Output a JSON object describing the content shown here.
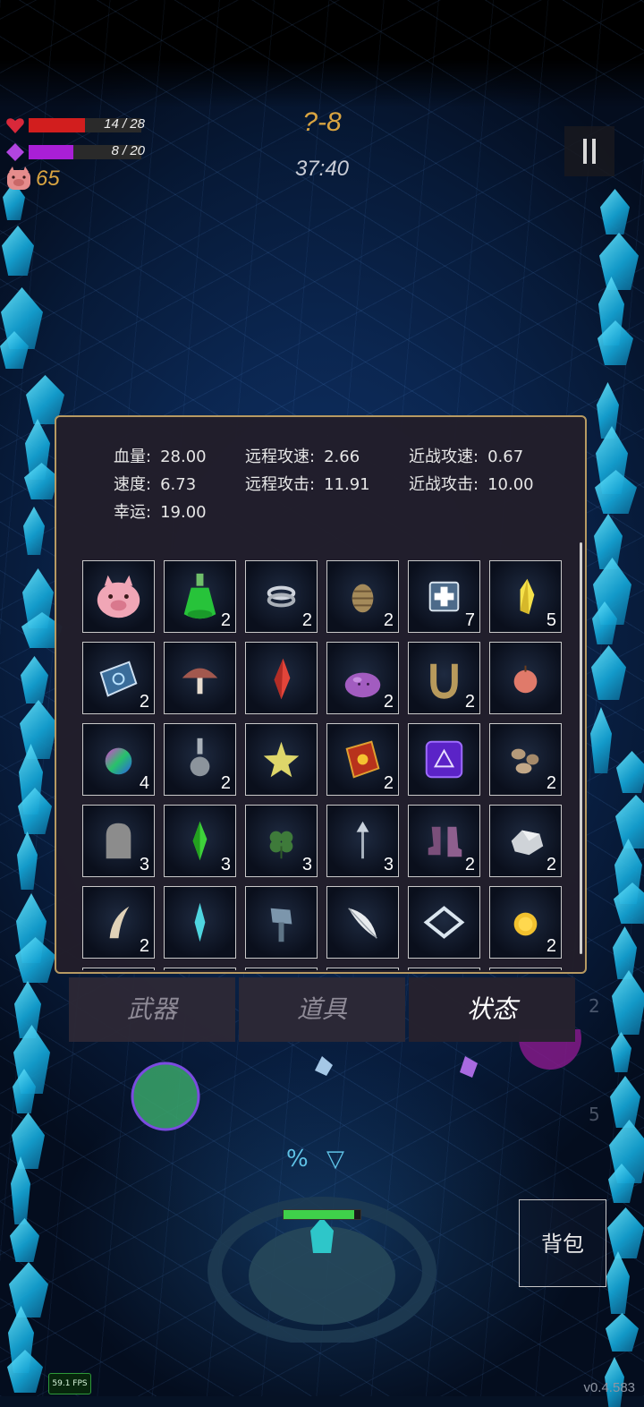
{
  "hud": {
    "hp_text": "14 / 28",
    "hp_current": 14,
    "hp_max": 28,
    "mp_text": "8 / 20",
    "mp_current": 8,
    "mp_max": 20,
    "coins": "65",
    "level": "?-8",
    "timer": "37:40",
    "hp_color": "#d21e1e",
    "mp_color": "#a91fd6",
    "level_color": "#d9a441"
  },
  "stats": {
    "hp_label": "血量:",
    "hp_value": "28.00",
    "speed_label": "速度:",
    "speed_value": "6.73",
    "luck_label": "幸运:",
    "luck_value": "19.00",
    "ranged_speed_label": "远程攻速:",
    "ranged_speed_value": "2.66",
    "ranged_atk_label": "远程攻击:",
    "ranged_atk_value": "11.91",
    "melee_speed_label": "近战攻速:",
    "melee_speed_value": "0.67",
    "melee_atk_label": "近战攻击:",
    "melee_atk_value": "10.00"
  },
  "items": [
    {
      "icon": "piggy-bank-icon",
      "count": ""
    },
    {
      "icon": "green-potion-icon",
      "count": "2"
    },
    {
      "icon": "silver-rings-icon",
      "count": "2"
    },
    {
      "icon": "pinecone-icon",
      "count": "2"
    },
    {
      "icon": "medkit-icon",
      "count": "7"
    },
    {
      "icon": "yellow-crystal-icon",
      "count": "5"
    },
    {
      "icon": "spellbook-icon",
      "count": "2"
    },
    {
      "icon": "mushroom-icon",
      "count": ""
    },
    {
      "icon": "red-crystal-icon",
      "count": ""
    },
    {
      "icon": "purple-slime-icon",
      "count": "2"
    },
    {
      "icon": "horseshoe-icon",
      "count": "2"
    },
    {
      "icon": "apple-icon",
      "count": ""
    },
    {
      "icon": "rainbow-orb-icon",
      "count": "4"
    },
    {
      "icon": "flask-icon",
      "count": "2"
    },
    {
      "icon": "golden-star-icon",
      "count": ""
    },
    {
      "icon": "red-tome-icon",
      "count": "2"
    },
    {
      "icon": "purple-rune-icon",
      "count": ""
    },
    {
      "icon": "rocks-icon",
      "count": "2"
    },
    {
      "icon": "tombstone-icon",
      "count": "3"
    },
    {
      "icon": "green-gem-icon",
      "count": "3"
    },
    {
      "icon": "clover-icon",
      "count": "3"
    },
    {
      "icon": "arrow-icon",
      "count": "3"
    },
    {
      "icon": "boots-icon",
      "count": "2"
    },
    {
      "icon": "silver-ore-icon",
      "count": "2"
    },
    {
      "icon": "fang-icon",
      "count": "2"
    },
    {
      "icon": "cyan-shard-icon",
      "count": ""
    },
    {
      "icon": "stone-hammer-icon",
      "count": ""
    },
    {
      "icon": "feather-icon",
      "count": ""
    },
    {
      "icon": "diamond-plate-icon",
      "count": ""
    },
    {
      "icon": "gold-coin-icon",
      "count": "2"
    }
  ],
  "tabs": {
    "weapons": "武器",
    "items": "道具",
    "status": "状态"
  },
  "bag_button": "背包",
  "ghost_counts": [
    "2",
    "5"
  ],
  "skill_symbols": "% ▽",
  "fps": "59.1 FPS",
  "version": "v0.4.583"
}
